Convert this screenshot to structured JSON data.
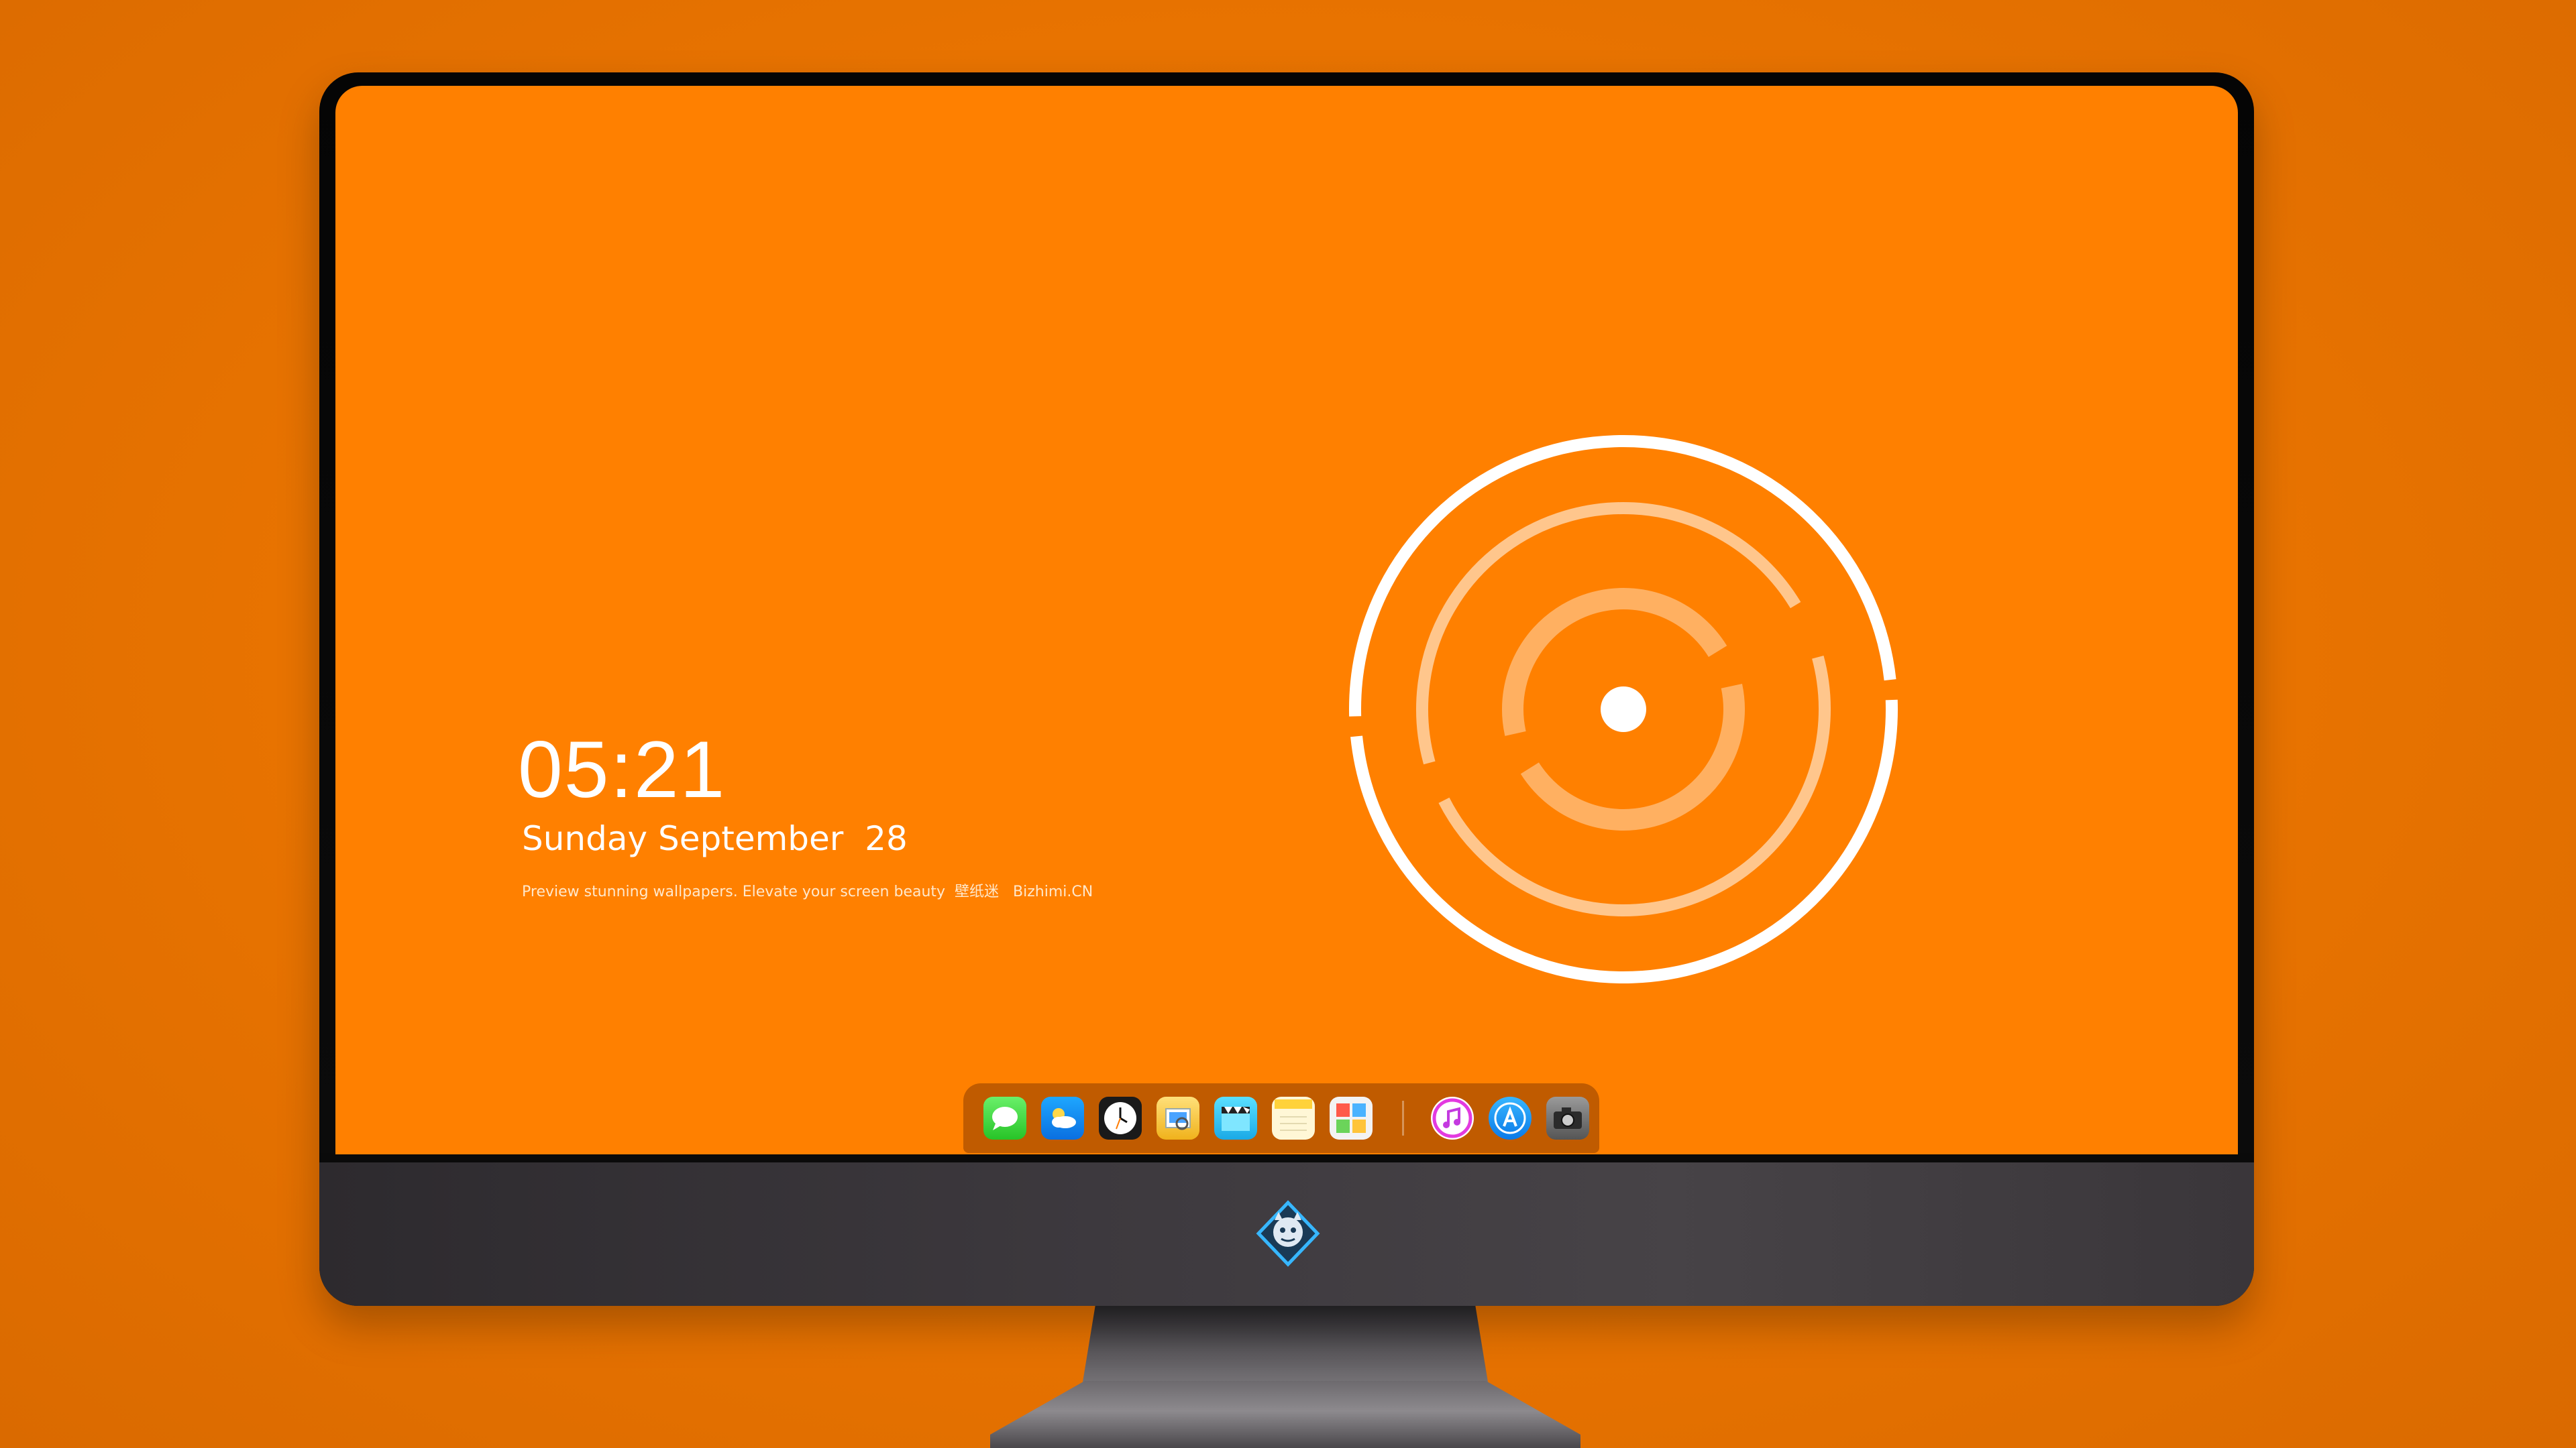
{
  "lock_screen": {
    "time": "05:21",
    "date": "Sunday September  28",
    "tagline": "Preview stunning wallpapers. Elevate your screen beauty  壁纸迷   Bizhimi.CN"
  },
  "dock": {
    "items": [
      {
        "name": "messages-icon"
      },
      {
        "name": "weather-icon"
      },
      {
        "name": "clock-icon"
      },
      {
        "name": "preview-icon"
      },
      {
        "name": "clips-icon"
      },
      {
        "name": "notes-icon"
      },
      {
        "name": "photo-booth-icon"
      },
      {
        "name": "itunes-icon"
      },
      {
        "name": "app-store-icon"
      },
      {
        "name": "camera-icon"
      }
    ]
  },
  "colors": {
    "wallpaper": "#FF8000",
    "background": "#E87300",
    "ring": "#FFFFFF"
  }
}
